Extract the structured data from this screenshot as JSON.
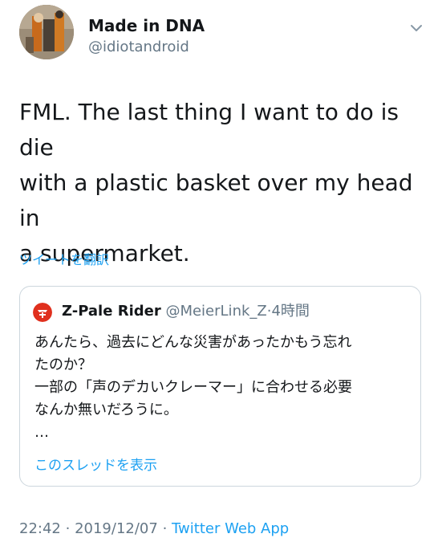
{
  "author": {
    "name": "Made in DNA",
    "handle": "@idiotandroid"
  },
  "tweet": {
    "text": "FML. The last thing I want to do is die\nwith a plastic basket over my head in\na supermarket.",
    "translate_label": "ツイートを翻訳"
  },
  "quote": {
    "name": "Z-Pale Rider",
    "handle": "@MeierLink_Z",
    "separator": "·",
    "time": "4時間",
    "text": "あんたら、過去にどんな災害があったかもう忘れ\nたのか？\n一部の「声のデカいクレーマー」に合わせる必要\nなんか無いだろうに。\n…",
    "show_thread_label": "このスレッドを表示",
    "icon_color": "#e0301e"
  },
  "meta": {
    "time": "22:42",
    "sep1": "·",
    "date": "2019/12/07",
    "sep2": "·",
    "source": "Twitter Web App"
  },
  "icons": {
    "menu": "chevron-down-icon",
    "avatar": "robot-figure-avatar",
    "quote_avatar": "rider-helmet-icon"
  },
  "colors": {
    "link": "#1da1f2",
    "secondary_text": "#657786",
    "border": "#ccd6dd"
  }
}
